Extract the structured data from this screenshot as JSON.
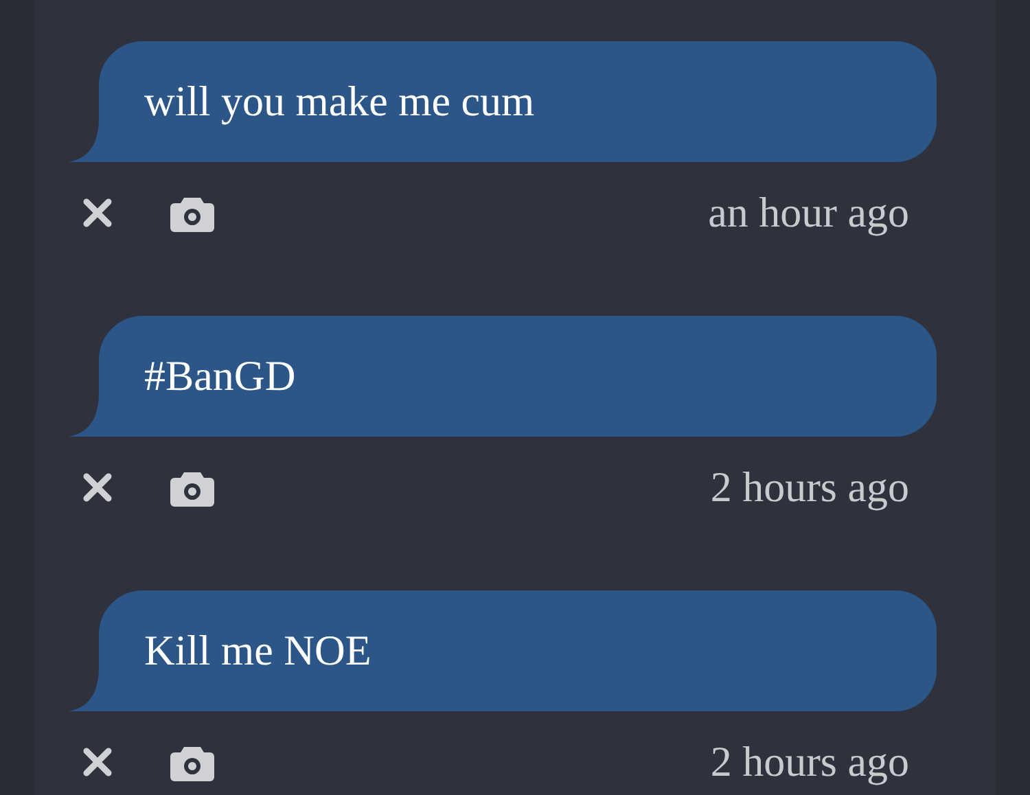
{
  "messages": [
    {
      "text": "will you make me cum",
      "time": "an hour ago"
    },
    {
      "text": "#BanGD",
      "time": "2 hours ago"
    },
    {
      "text": "Kill me NOE",
      "time": "2 hours ago"
    }
  ]
}
